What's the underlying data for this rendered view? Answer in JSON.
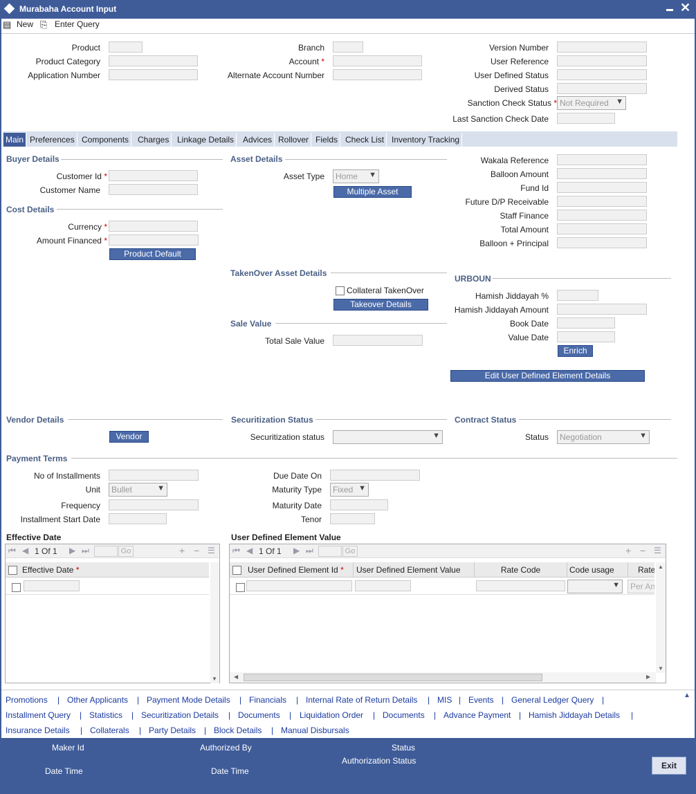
{
  "window": {
    "title": "Murabaha Account Input"
  },
  "toolbar": {
    "new_label": "New",
    "enter_query_label": "Enter Query"
  },
  "header": {
    "product": "Product",
    "product_category": "Product Category",
    "application_number": "Application Number",
    "branch": "Branch",
    "account": "Account",
    "alternate_account_number": "Alternate Account Number",
    "version_number": "Version Number",
    "user_reference": "User Reference",
    "user_defined_status": "User Defined Status",
    "derived_status": "Derived Status",
    "sanction_check_status": "Sanction Check Status",
    "sanction_value": "Not Required",
    "last_sanction_check_date": "Last Sanction Check Date"
  },
  "tabs": [
    "Main",
    "Preferences",
    "Components",
    "Charges",
    "Linkage Details",
    "Advices",
    "Rollover",
    "Fields",
    "Check List",
    "Inventory Tracking"
  ],
  "buyer": {
    "title": "Buyer Details",
    "customer_id": "Customer Id",
    "customer_name": "Customer Name"
  },
  "cost": {
    "title": "Cost Details",
    "currency": "Currency",
    "amount_financed": "Amount Financed",
    "product_default": "Product Default"
  },
  "asset": {
    "title": "Asset Details",
    "asset_type": "Asset Type",
    "asset_type_value": "Home",
    "multiple_asset": "Multiple Asset"
  },
  "right": {
    "wakala_reference": "Wakala Reference",
    "balloon_amount": "Balloon Amount",
    "fund_id": "Fund Id",
    "future_dp": "Future D/P Receivable",
    "staff_finance": "Staff Finance",
    "total_amount": "Total Amount",
    "balloon_principal": "Balloon + Principal"
  },
  "takenover": {
    "title": "TakenOver Asset Details",
    "collateral": "Collateral TakenOver",
    "takeover_details": "Takeover Details"
  },
  "sale": {
    "title": "Sale Value",
    "total_sale_value": "Total Sale Value"
  },
  "urboun": {
    "title": "URBOUN",
    "hamish_pct": "Hamish Jiddayah %",
    "hamish_amount": "Hamish Jiddayah Amount",
    "book_date": "Book Date",
    "value_date": "Value Date",
    "enrich": "Enrich",
    "edit_udf": "Edit User Defined Element Details"
  },
  "vendor": {
    "title": "Vendor Details",
    "button": "Vendor"
  },
  "securitization": {
    "title": "Securitization Status",
    "label": "Securitization status"
  },
  "contract": {
    "title": "Contract Status",
    "status": "Status",
    "status_value": "Negotiation"
  },
  "payment": {
    "title": "Payment Terms",
    "no_installments": "No of Installments",
    "unit": "Unit",
    "unit_value": "Bullet",
    "frequency": "Frequency",
    "installment_start": "Installment Start Date",
    "due_date_on": "Due Date On",
    "maturity_type": "Maturity Type",
    "maturity_type_value": "Fixed",
    "maturity_date": "Maturity Date",
    "tenor": "Tenor"
  },
  "effective": {
    "title": "Effective Date",
    "page": "1 Of 1",
    "go": "Go",
    "col": "Effective Date"
  },
  "udev": {
    "title": "User Defined Element Value",
    "page": "1 Of 1",
    "go": "Go",
    "cols": [
      "User Defined Element Id",
      "User Defined Element Value",
      "Rate Code",
      "Code usage",
      "Rate"
    ],
    "per_placeholder": "Per An"
  },
  "links": {
    "row1": [
      "Promotions",
      "Other Applicants",
      "Payment Mode Details",
      "Financials",
      "Internal Rate of Return Details",
      "MIS",
      "Events",
      "General Ledger Query"
    ],
    "row2": [
      "Installment Query",
      "Statistics",
      "Securitization Details",
      "Documents",
      "Liquidation Order",
      "Documents",
      "Advance Payment",
      "Hamish Jiddayah Details"
    ],
    "row3": [
      "Insurance Details",
      "Collaterals",
      "Party Details",
      "Block Details",
      "Manual Disbursals"
    ]
  },
  "footer": {
    "maker_id": "Maker Id",
    "date_time": "Date Time",
    "authorized_by": "Authorized By",
    "date_time2": "Date Time",
    "status": "Status",
    "authorization_status": "Authorization Status",
    "exit": "Exit"
  }
}
